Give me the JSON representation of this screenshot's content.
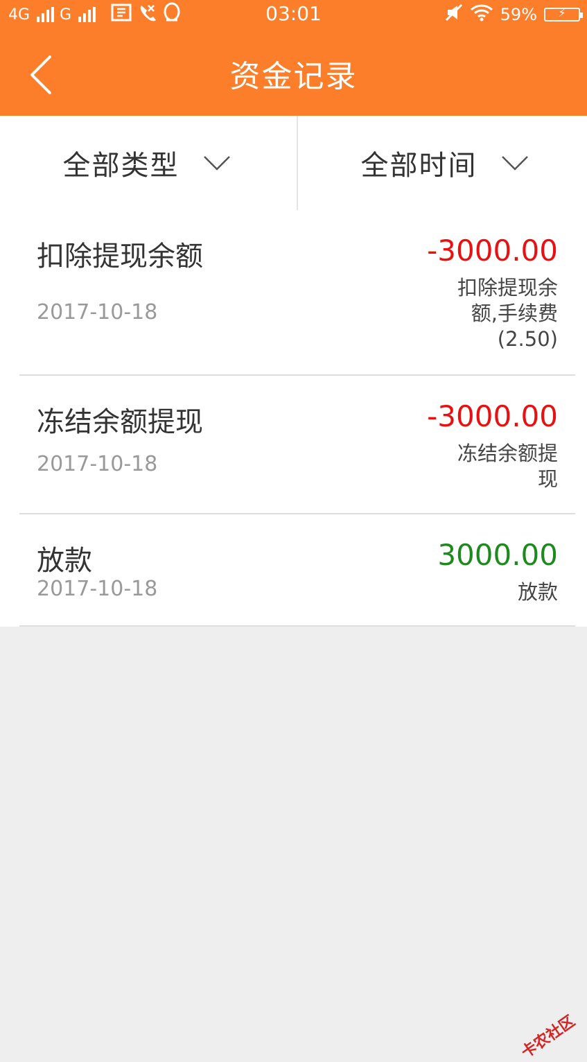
{
  "status": {
    "network1": "4G",
    "network2": "G",
    "time": "03:01",
    "battery": "59%"
  },
  "header": {
    "title": "资金记录"
  },
  "filters": {
    "type_label": "全部类型",
    "time_label": "全部时间"
  },
  "records": [
    {
      "name": "扣除提现余额",
      "date": "2017-10-18",
      "amount": "-3000.00",
      "desc": "扣除提现余额,手续费(2.50)"
    },
    {
      "name": "冻结余额提现",
      "date": "2017-10-18",
      "amount": "-3000.00",
      "desc": "冻结余额提现"
    },
    {
      "name": "放款",
      "date": "2017-10-18",
      "amount": "3000.00",
      "desc": "放款"
    }
  ],
  "watermark": "卡农社区",
  "colors": {
    "brand": "#fc7d2a",
    "negative": "#e81010",
    "positive": "#1e8a1e"
  }
}
